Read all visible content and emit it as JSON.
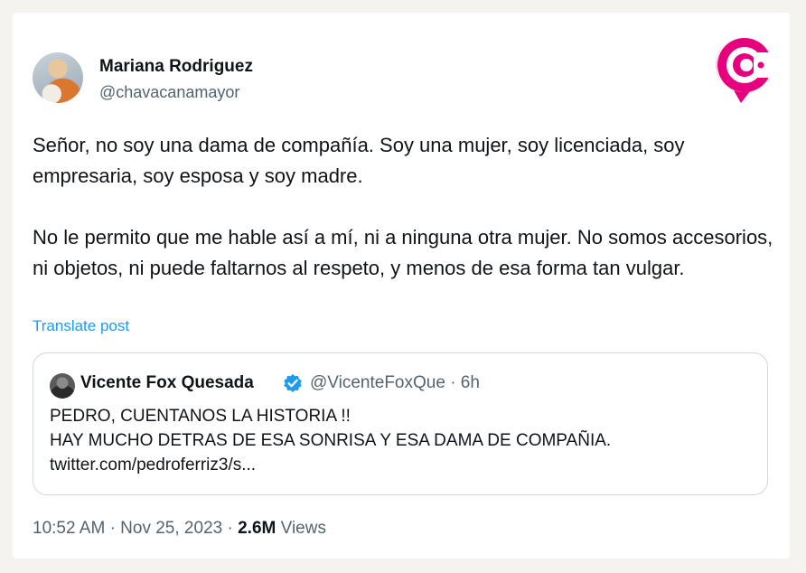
{
  "tweet": {
    "author_name": "Mariana Rodriguez",
    "author_handle": "@chavacanamayor",
    "paragraph_1": "Señor, no soy una dama de compañía. Soy una mujer, soy licenciada, soy empresaria, soy esposa y soy madre.",
    "paragraph_2": "No le permito que me hable así a mí, ni a ninguna otra mujer. No somos accesorios, ni objetos, ni puede faltarnos al respeto, y menos de esa forma tan vulgar.",
    "translate_label": "Translate post",
    "time": "10:52 AM",
    "date": "Nov 25, 2023",
    "views_count": "2.6M",
    "views_label": "Views"
  },
  "quote": {
    "author_name": "Vicente Fox Quesada",
    "author_handle": "@VicenteFoxQue",
    "age": "6h",
    "line_1": "PEDRO, CUENTANOS LA HISTORIA !!",
    "line_2": "HAY MUCHO DETRAS DE ESA SONRISA Y ESA DAMA DE COMPAÑIA.",
    "link": "twitter.com/pedroferriz3/s..."
  },
  "icons": {
    "logo": "brand-logo-icon",
    "verified": "verified-badge-icon"
  },
  "colors": {
    "link_blue": "#1d9bf0",
    "verified_blue": "#1d9bf0",
    "logo_pink": "#e6007e",
    "muted_text": "#536471"
  }
}
